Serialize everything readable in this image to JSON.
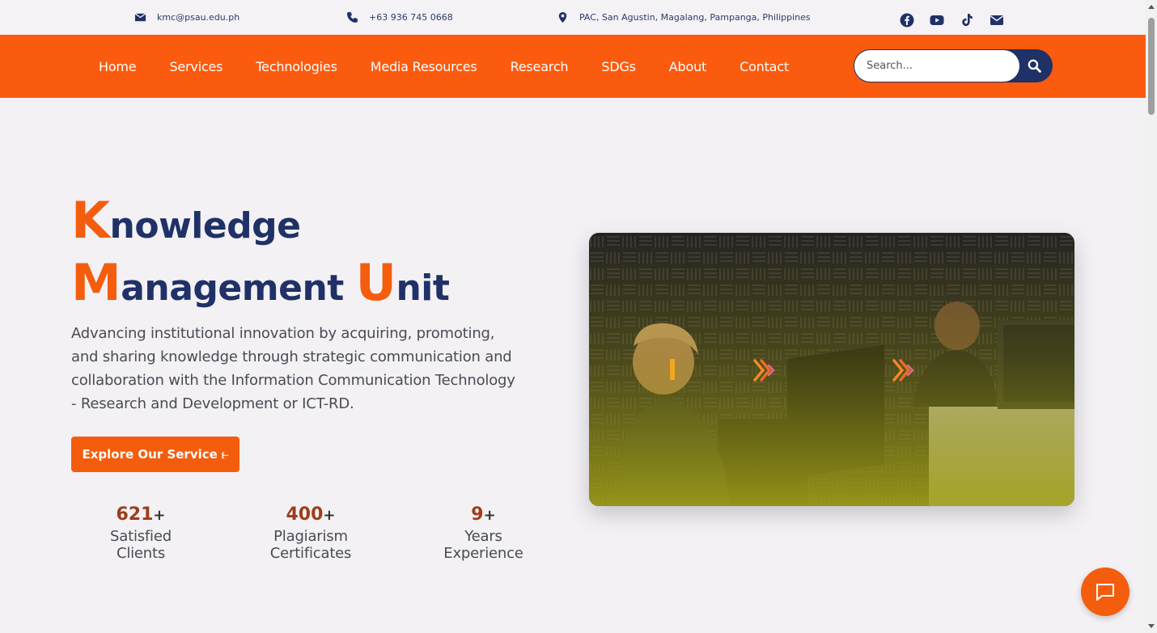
{
  "topbar": {
    "email": "kmc@psau.edu.ph",
    "phone": "+63 936 745 0668",
    "address": "PAC, San Agustin, Magalang, Pampanga, Philippines",
    "social_icons": [
      "facebook-icon",
      "youtube-icon",
      "tiktok-icon",
      "envelope-icon"
    ]
  },
  "nav": {
    "items": [
      {
        "label": "Home"
      },
      {
        "label": "Services"
      },
      {
        "label": "Technologies"
      },
      {
        "label": "Media Resources"
      },
      {
        "label": "Research"
      },
      {
        "label": "SDGs"
      },
      {
        "label": "About"
      },
      {
        "label": "Contact"
      }
    ],
    "search_placeholder": "Search..."
  },
  "hero": {
    "title_line1_initial": "K",
    "title_line1_rest": "nowledge",
    "title_line2_initial1": "M",
    "title_line2_rest1": "anagement ",
    "title_line2_initial2": "U",
    "title_line2_rest2": "nit",
    "description": "Advancing institutional innovation by acquiring, promoting, and sharing knowledge through strategic communication and collaboration with the Information Communication Technology - Research and Development or ICT-RD.",
    "cta_label": "Explore Our Service ⥼"
  },
  "stats": [
    {
      "number": "621",
      "suffix": "+",
      "label": "Satisfied Clients"
    },
    {
      "number": "400",
      "suffix": "+",
      "label": "Plagiarism Certificates"
    },
    {
      "number": "9",
      "suffix": "+",
      "label": "Years Experience"
    }
  ],
  "colors": {
    "accent": "#f45d0d",
    "navy": "#1f3167",
    "background": "#f3f1f4"
  }
}
